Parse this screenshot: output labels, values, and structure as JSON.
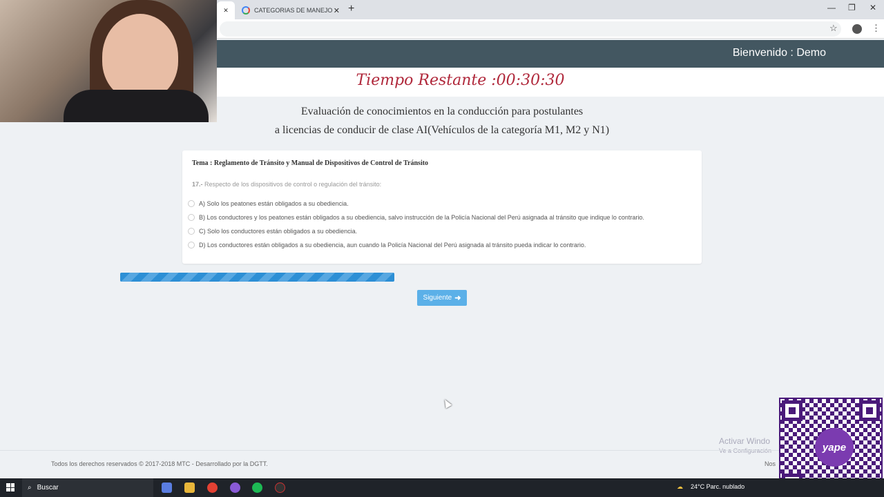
{
  "browser": {
    "tab_active_close": "✕",
    "tab_title": "CATEGORIAS DE MANEJO - Bu",
    "tab_close": "✕",
    "new_tab": "+",
    "minimize": "—",
    "restore": "❐",
    "close": "✕"
  },
  "header": {
    "welcome": "Bienvenido : Demo",
    "timer": "Tiempo Restante :00:30:30"
  },
  "exam": {
    "title_line1": "Evaluación de conocimientos en la conducción para postulantes",
    "title_line2": "a licencias de conducir de clase AI(Vehículos de la categoría M1, M2 y N1)",
    "topic": "Tema : Reglamento de Tránsito y Manual de Dispositivos de Control de Tránsito",
    "question_number": "17.-",
    "question_text": "Respecto de los dispositivos de control o regulación del tránsito:",
    "options": [
      "A) Solo los peatones están obligados a su obediencia.",
      "B) Los conductores y los peatones están obligados a su obediencia, salvo instrucción de la Policía Nacional del Perú asignada al tránsito que indique lo contrario.",
      "C) Solo los conductores están obligados a su obediencia.",
      "D) Los conductores están obligados a su obediencia, aun cuando la Policía Nacional del Perú asignada al tránsito pueda indicar lo contrario."
    ],
    "next_label": "Siguiente",
    "next_arrow": "➜"
  },
  "footer": {
    "copyright": "Todos los derechos reservados © 2017-2018 MTC - Desarrollado por la DGTT.",
    "right_text": "Nos",
    "activate_title": "Activar Windo",
    "activate_sub": "Ve a Configuración"
  },
  "overlay": {
    "qr_logo": "yape"
  },
  "taskbar": {
    "search_label": "Buscar",
    "search_icon": "⌕",
    "weather": "24°C  Parc. nublado"
  },
  "colors": {
    "topbar": "#435761",
    "timer": "#b0283b",
    "progress": "#2d8fd5",
    "button": "#5bb0e8"
  }
}
